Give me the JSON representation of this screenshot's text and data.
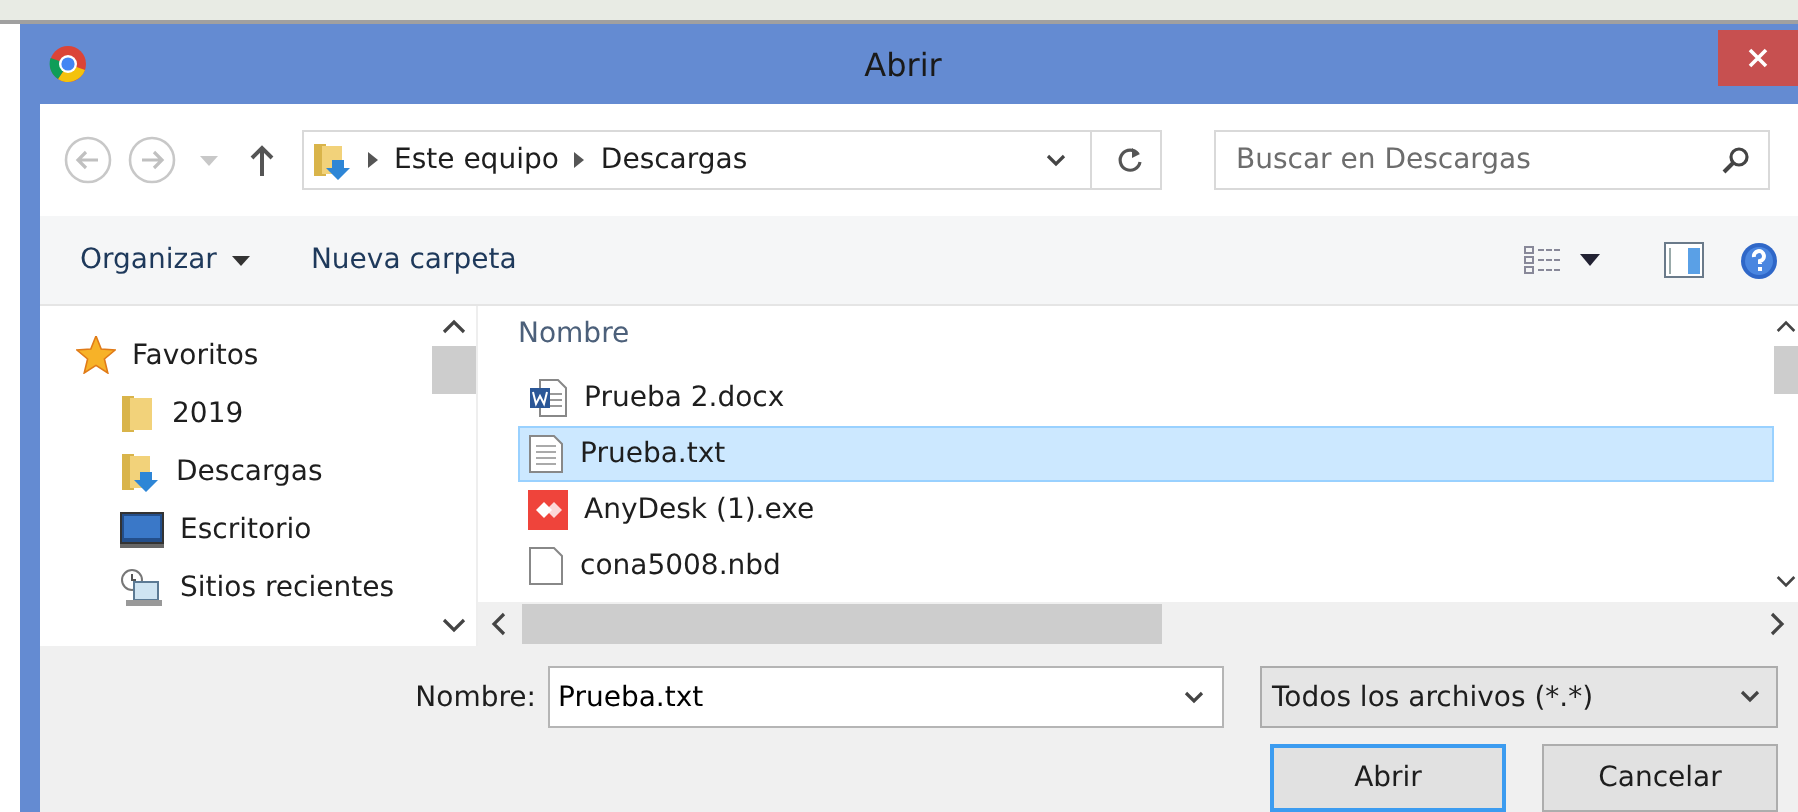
{
  "window": {
    "title": "Abrir"
  },
  "nav": {
    "path": [
      "Este equipo",
      "Descargas"
    ],
    "search": {
      "placeholder": "Buscar en Descargas"
    }
  },
  "toolbar": {
    "organize": "Organizar",
    "new_folder": "Nueva carpeta"
  },
  "sidebar": {
    "items": [
      {
        "label": "Favoritos",
        "kind": "star",
        "children": [
          {
            "label": "2019",
            "kind": "folder"
          },
          {
            "label": "Descargas",
            "kind": "downloads"
          },
          {
            "label": "Escritorio",
            "kind": "desktop"
          },
          {
            "label": "Sitios recientes",
            "kind": "recent"
          }
        ]
      }
    ]
  },
  "files": {
    "column": "Nombre",
    "rows": [
      {
        "name": "Prueba 2.docx",
        "kind": "word",
        "selected": false
      },
      {
        "name": "Prueba.txt",
        "kind": "text",
        "selected": true
      },
      {
        "name": "AnyDesk (1).exe",
        "kind": "app",
        "selected": false
      },
      {
        "name": "cona5008.nbd",
        "kind": "file",
        "selected": false
      }
    ]
  },
  "footer": {
    "name_label": "Nombre:",
    "name_value": "Prueba.txt",
    "filter": "Todos los archivos (*.*)",
    "buttons": [
      {
        "label": "Abrir",
        "default": true
      },
      {
        "label": "Cancelar",
        "default": false
      }
    ]
  }
}
